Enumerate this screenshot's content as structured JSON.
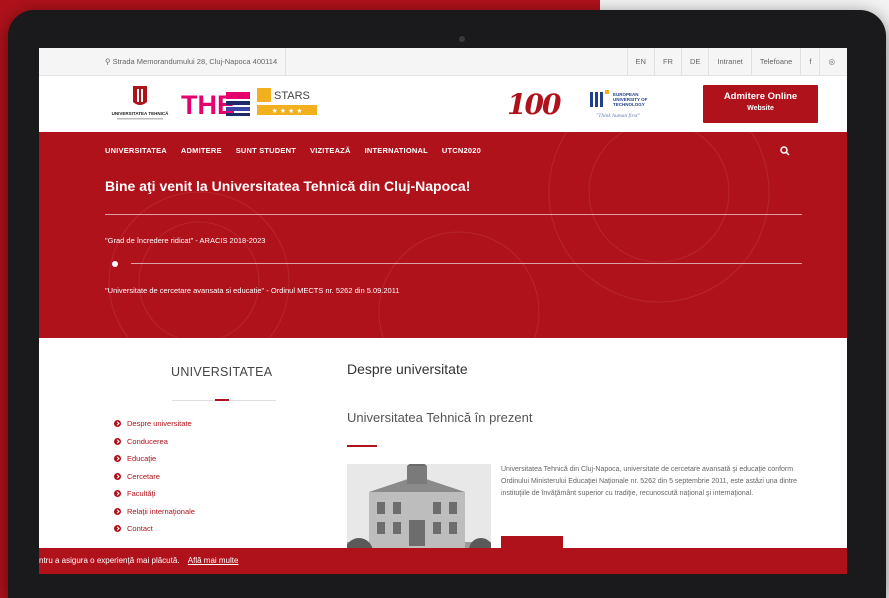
{
  "topbar": {
    "address": "Strada Memorandumului 28, Cluj-Napoca 400114",
    "links": [
      "EN",
      "FR",
      "DE",
      "Intranet",
      "Telefoane",
      "f",
      "◎"
    ]
  },
  "logos": {
    "utcn_caption": "UNIVERSITATEA TEHNICĂ",
    "the_label": "THE",
    "stars_label": "STARS",
    "hundred": "100",
    "eut_lines": [
      "EUROPEAN",
      "UNIVERSITY OF",
      "TECHNOLOGY"
    ],
    "eut_slogan": "\"Think human first\""
  },
  "admission": {
    "title": "Admitere Online",
    "subtitle": "Website"
  },
  "nav": {
    "items": [
      "UNIVERSITATEA",
      "ADMITERE",
      "SUNT STUDENT",
      "VIZITEAZĂ",
      "INTERNATIONAL",
      "UTCN2020"
    ]
  },
  "hero": {
    "welcome": "Bine aţi venit la Universitatea Tehnică din Cluj-Napoca!",
    "grade": "\"Grad de încredere ridicat\" - ARACIS 2018-2023",
    "certification": "\"Universitate de cercetare avansata si educatie\" - Ordinul MECTS nr. 5262 din 5.09.2011"
  },
  "sidebar": {
    "title": "UNIVERSITATEA",
    "items": [
      "Despre universitate",
      "Conducerea",
      "Educaţie",
      "Cercetare",
      "Facultăţi",
      "Relaţii internaţionale",
      "Contact"
    ]
  },
  "main": {
    "title": "Despre universitate",
    "subtitle": "Universitatea Tehnică în prezent",
    "paragraph": "Universitatea Tehnică din Cluj-Napoca, universitate de cercetare avansată şi educaţie conform Ordinului Ministerului Educaţiei Naţionale nr. 5262 din 5 septembrie 2011, este astăzi una dintre instituţiile de învăţământ superior cu tradiţie, recunoscută naţional şi internaţional."
  },
  "cookie": {
    "text": "ntru a asigura o experienţă mai plăcută.",
    "link": "Află mai multe"
  },
  "colors": {
    "brand_red": "#b0121b",
    "frame": "#1a1a1c"
  }
}
